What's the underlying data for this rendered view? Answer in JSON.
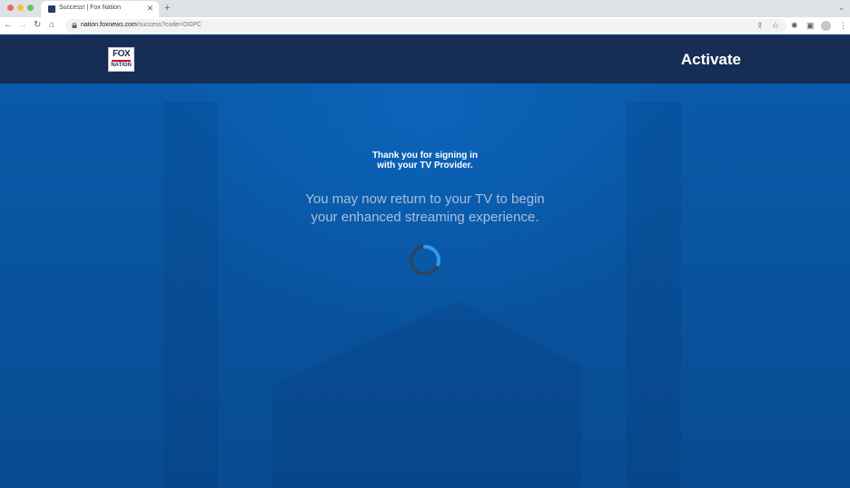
{
  "browser": {
    "tab": {
      "title": "Success! | Fox Nation",
      "close_glyph": "✕"
    },
    "new_tab_glyph": "+",
    "tab_menu_glyph": "⌄",
    "nav": {
      "back": "←",
      "forward": "→",
      "reload": "↻",
      "home": "⌂"
    },
    "url": {
      "host": "nation.foxnews.com",
      "path": "/success?code=OGPC"
    },
    "icons": {
      "share": "⇪",
      "star": "☆",
      "extensions": "✱",
      "side_panel": "▣",
      "menu": "⋮"
    }
  },
  "header": {
    "logo": {
      "top": "FOX",
      "bottom": "NATION"
    },
    "title": "Activate"
  },
  "main": {
    "thank_you_line1": "Thank you for signing in",
    "thank_you_line2": "with your TV Provider.",
    "return_line1": "You may now return to your TV to begin",
    "return_line2": "your enhanced streaming experience."
  },
  "colors": {
    "header_bg": "#162e55",
    "page_bg": "#0a5aa9",
    "spinner_accent": "#2f9bf0",
    "spinner_track": "#2d4466"
  }
}
